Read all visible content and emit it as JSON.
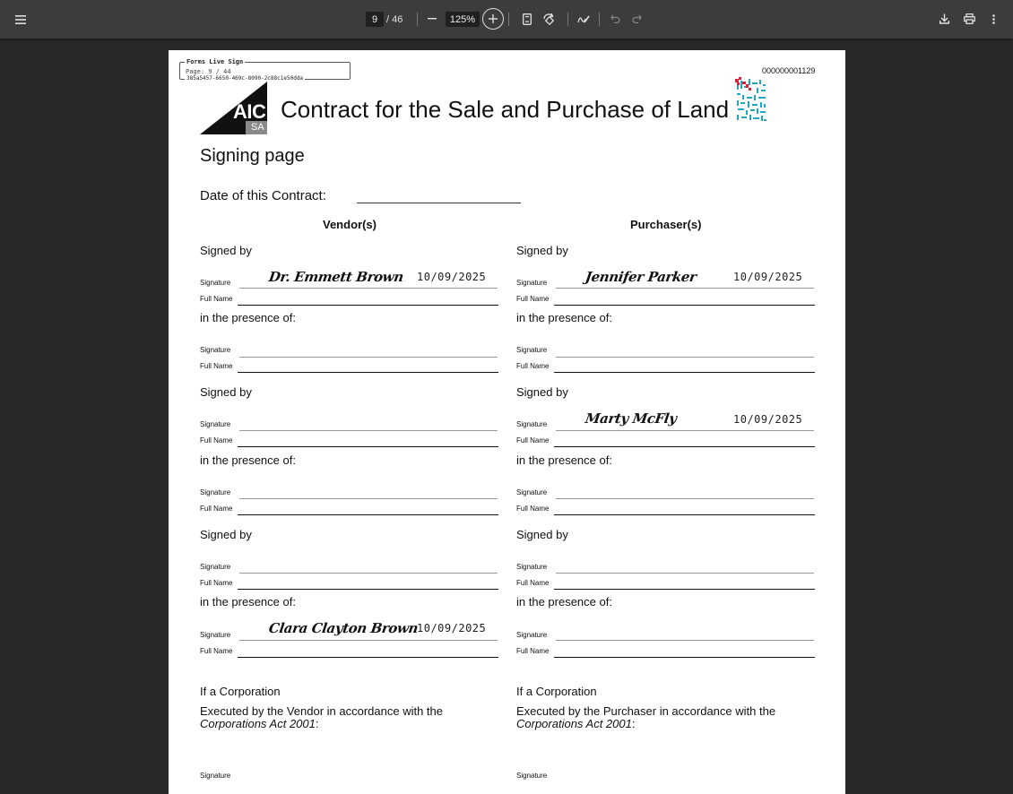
{
  "toolbar": {
    "page_current": "9",
    "page_total": "/ 46",
    "zoom": "125%",
    "icons": [
      "menu-icon",
      "zoom-out-icon",
      "zoom-in-icon",
      "fit-page-icon",
      "rotate-icon",
      "draw-icon",
      "undo-icon",
      "redo-icon",
      "download-icon",
      "print-icon",
      "more-icon"
    ]
  },
  "stamp": {
    "title": "Forms Live Sign",
    "page": "Page: 9 / 44",
    "id": "385a5457-6650-469c-8090-2c88c1e50dda"
  },
  "doc_number": "000000001129",
  "logo": {
    "main": "AIC",
    "sub": "SA"
  },
  "title": "Contract for the Sale and Purchase of Land",
  "subtitle": "Signing page",
  "date_label": "Date of this Contract:",
  "vendor_header": "Vendor(s)",
  "purchaser_header": "Purchaser(s)",
  "labels": {
    "signed_by": "Signed by",
    "presence": "in the presence of:",
    "signature": "Signature",
    "full_name": "Full Name",
    "if_corp": "If a Corporation",
    "corp_act": "Corporations Act 2001",
    "colon": ":"
  },
  "vendor_exec": "Executed by the Vendor in accordance with the",
  "purchaser_exec": "Executed by the Purchaser in accordance with the",
  "signatures": {
    "vendor_1": {
      "name": "Dr. Emmett Brown",
      "date": "10/09/2025"
    },
    "purchaser_1": {
      "name": "Jennifer Parker",
      "date": "10/09/2025"
    },
    "purchaser_2": {
      "name": "Marty McFly",
      "date": "10/09/2025"
    },
    "vendor_witness_3": {
      "name": "Clara Clayton Brown",
      "date": "10/09/2025"
    }
  }
}
